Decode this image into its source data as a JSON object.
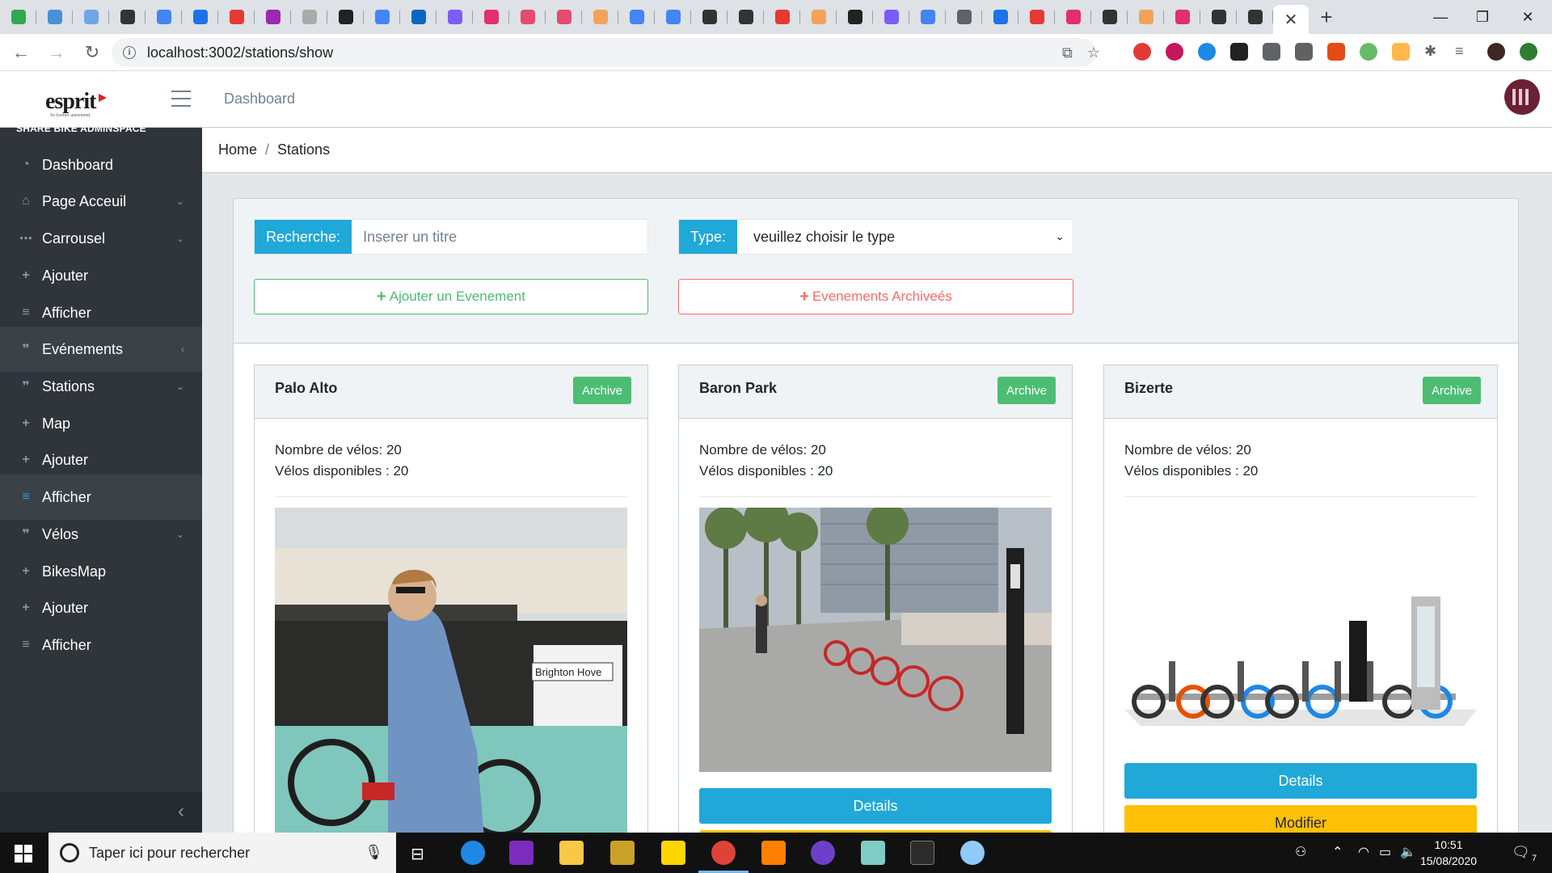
{
  "browser": {
    "url": "localhost:3002/stations/show",
    "close_tab_glyph": "✕",
    "new_tab_glyph": "+",
    "tab_favicons": [
      "#31a852",
      "#4a90d9",
      "#6ea6e8",
      "#333333",
      "#4285f4",
      "#1a73e8",
      "#e53935",
      "#9c27b0",
      "#aaaaaa",
      "#222222",
      "#4285f4",
      "#0a66c2",
      "#7c5cff",
      "#e1306c",
      "#e34c6e",
      "#e34c6e",
      "#f4a259",
      "#4285f4",
      "#4285f4",
      "#333333",
      "#333333",
      "#e53935",
      "#f4a259",
      "#222222",
      "#7c5cff",
      "#4285f4",
      "#5f6368",
      "#1a73e8",
      "#e53935",
      "#e1306c",
      "#333333",
      "#f4a259",
      "#e1306c",
      "#333333",
      "#333333"
    ]
  },
  "header": {
    "logo": "esprit",
    "logo_tagline": "Se former autrement",
    "link": "Dashboard"
  },
  "sidebar": {
    "brand": "SHARE BIKE ADMINSPACE",
    "items": [
      {
        "label": "Dashboard",
        "icon": "◔",
        "chevron": ""
      },
      {
        "label": "Page Acceuil",
        "icon": "⌂",
        "chevron": "⌄"
      },
      {
        "label": "Carrousel",
        "icon": "⋯",
        "chevron": "⌄"
      },
      {
        "label": "Ajouter",
        "icon": "+",
        "chevron": ""
      },
      {
        "label": "Afficher",
        "icon": "≡",
        "chevron": ""
      },
      {
        "label": "Evénements",
        "icon": "❞",
        "chevron": "‹"
      },
      {
        "label": "Stations",
        "icon": "❞",
        "chevron": "⌄"
      },
      {
        "label": "Map",
        "icon": "+",
        "chevron": ""
      },
      {
        "label": "Ajouter",
        "icon": "+",
        "chevron": ""
      },
      {
        "label": "Afficher",
        "icon": "≡",
        "chevron": ""
      },
      {
        "label": "Vélos",
        "icon": "❞",
        "chevron": "⌄"
      },
      {
        "label": "BikesMap",
        "icon": "+",
        "chevron": ""
      },
      {
        "label": "Ajouter",
        "icon": "+",
        "chevron": ""
      },
      {
        "label": "Afficher",
        "icon": "≡",
        "chevron": ""
      }
    ],
    "minimize_glyph": "‹"
  },
  "breadcrumb": {
    "home": "Home",
    "separator": "/",
    "current": "Stations"
  },
  "filters": {
    "search_label": "Recherche:",
    "search_placeholder": "Inserer un titre",
    "type_label": "Type:",
    "type_selected": "veuillez choisir le type",
    "add_button": "Ajouter un Evenement",
    "archived_button": "Evenements Archiveés"
  },
  "cards": [
    {
      "title": "Palo Alto",
      "archive": "Archive",
      "bikes": "Nombre de vélos: 20",
      "available": "Vélos disponibles : 20",
      "details": "",
      "modify": ""
    },
    {
      "title": "Baron Park",
      "archive": "Archive",
      "bikes": "Nombre de vélos: 20",
      "available": "Vélos disponibles : 20",
      "details": "Details",
      "modify": ""
    },
    {
      "title": "Bizerte",
      "archive": "Archive",
      "bikes": "Nombre de vélos: 20",
      "available": "Vélos disponibles : 20",
      "details": "Details",
      "modify": "Modifier"
    }
  ],
  "taskbar": {
    "search_placeholder": "Taper ici pour rechercher",
    "time": "10:51",
    "date": "15/08/2020",
    "notification_count": "7"
  },
  "colors": {
    "primary": "#20a8d8",
    "success": "#4dbd74",
    "danger": "#f86c6b",
    "warning": "#ffc107",
    "sidebar": "#2f353a"
  }
}
